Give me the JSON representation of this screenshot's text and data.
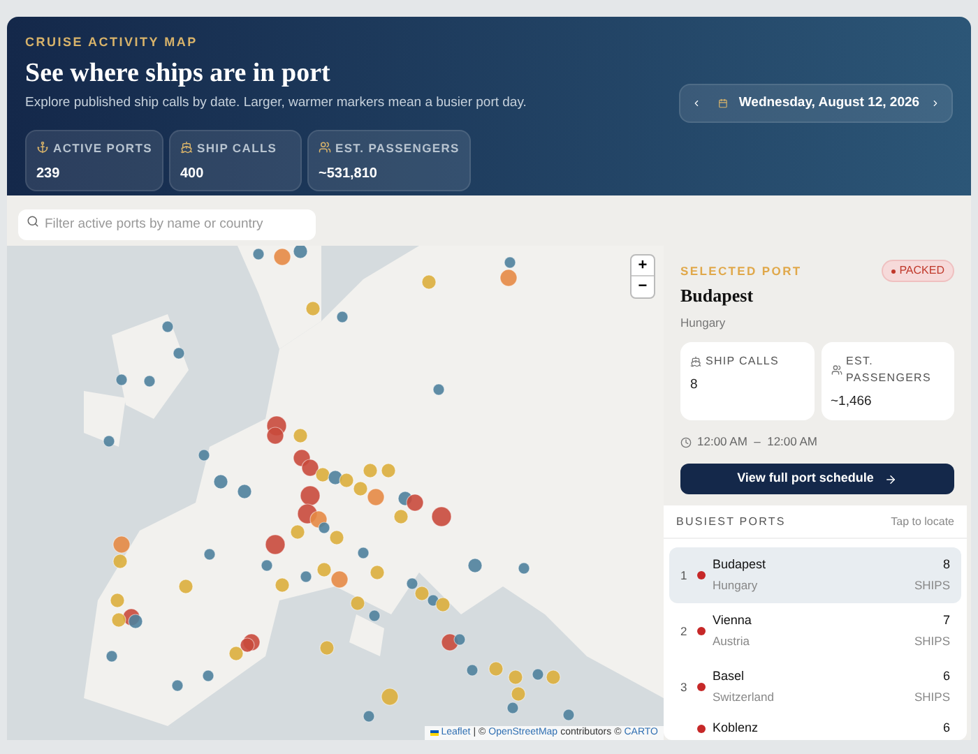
{
  "header": {
    "eyebrow": "CRUISE ACTIVITY MAP",
    "title": "See where ships are in port",
    "subtitle": "Explore published ship calls by date. Larger, warmer markers mean a busier port day.",
    "stats": [
      {
        "label": "ACTIVE PORTS",
        "value": "239"
      },
      {
        "label": "SHIP CALLS",
        "value": "400"
      },
      {
        "label": "EST. PASSENGERS",
        "value": "~531,810"
      }
    ],
    "date": "Wednesday, August 12, 2026"
  },
  "search": {
    "placeholder": "Filter active ports by name or country"
  },
  "map": {
    "zoom_in": "+",
    "zoom_out": "−",
    "attribution": {
      "leaflet": "Leaflet",
      "sep": "| ©",
      "osm": "OpenStreetMap",
      "mid": "contributors ©",
      "carto": "CARTO"
    }
  },
  "selected_port": {
    "eyebrow": "SELECTED PORT",
    "status": {
      "label": "PACKED",
      "color": "#c0392b"
    },
    "name": "Budapest",
    "country": "Hungary",
    "stats": [
      {
        "label": "SHIP CALLS",
        "value": "8"
      },
      {
        "label": "EST. PASSENGERS",
        "value": "~1,466"
      }
    ],
    "hours": "12:00 AM  –  12:00 AM",
    "button": "View full port schedule"
  },
  "busiest": {
    "title": "BUSIEST PORTS",
    "hint": "Tap to locate",
    "rows": [
      {
        "rank": "1",
        "name": "Budapest",
        "country": "Hungary",
        "count": "8",
        "unit": "SHIPS",
        "color": "#c62828",
        "selected": true
      },
      {
        "rank": "2",
        "name": "Vienna",
        "country": "Austria",
        "count": "7",
        "unit": "SHIPS",
        "color": "#c62828",
        "selected": false
      },
      {
        "rank": "3",
        "name": "Basel",
        "country": "Switzerland",
        "count": "6",
        "unit": "SHIPS",
        "color": "#c62828",
        "selected": false
      },
      {
        "name": "Koblenz",
        "count": "6",
        "color": "#c62828",
        "selected": false
      }
    ]
  }
}
